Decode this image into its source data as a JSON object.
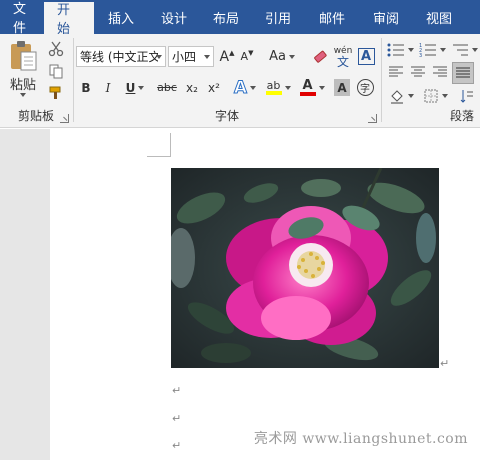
{
  "tabs": [
    "文件",
    "开始",
    "插入",
    "设计",
    "布局",
    "引用",
    "邮件",
    "审阅",
    "视图"
  ],
  "active_tab": "开始",
  "clipboard": {
    "paste_label": "粘贴",
    "group_label": "剪贴板"
  },
  "font": {
    "font_name": "等线 (中文正文",
    "font_size": "小四",
    "grow_label": "A",
    "shrink_label": "A",
    "case_label": "Aa",
    "phonetic_top": "wén",
    "phonetic_bottom": "文",
    "bold": "B",
    "italic": "I",
    "underline": "U",
    "strike": "abc",
    "subscript": "x₂",
    "superscript": "x²",
    "effects_label": "A",
    "highlight_label": "ab",
    "color_label": "A",
    "shade_label": "A",
    "enclose_label": "字",
    "group_label": "字体",
    "highlight_color": "#ffff00",
    "font_color": "#e00000"
  },
  "paragraph": {
    "group_label": "段落"
  },
  "document": {
    "para_mark": "↵",
    "watermark": "亮术网 www.liangshunet.com"
  },
  "colors": {
    "accent": "#2b579a",
    "ribbon_bg": "#f3f3f3"
  }
}
